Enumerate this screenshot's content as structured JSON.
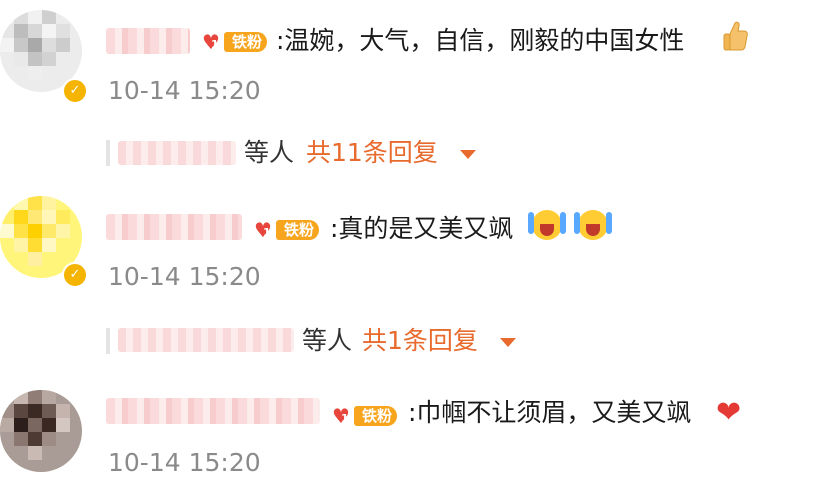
{
  "comments": [
    {
      "fan_badge": {
        "level": "1",
        "label": "铁粉"
      },
      "text": ":温婉，大气，自信，刚毅的中国女性",
      "emoji": "thumbs-up",
      "time": "10-14 15:20",
      "reply_summary": {
        "suffix": "等人",
        "count_text": "共11条回复"
      }
    },
    {
      "fan_badge": {
        "level": "1",
        "label": "铁粉"
      },
      "text": ":真的是又美又飒",
      "emoji": "cheering-face x2",
      "time": "10-14 15:20",
      "reply_summary": {
        "suffix": "等人",
        "count_text": "共1条回复"
      }
    },
    {
      "fan_badge": {
        "level": "1",
        "label": "铁粉"
      },
      "text": ":巾帼不让须眉，又美又飒",
      "emoji": "red-heart",
      "time": "10-14 15:20"
    }
  ],
  "colors": {
    "link": "#e86a2c",
    "timestamp": "#8a8a8a",
    "text": "#1a1a1a",
    "fan_badge": "#f7a51d",
    "verify": "#f4b400"
  }
}
